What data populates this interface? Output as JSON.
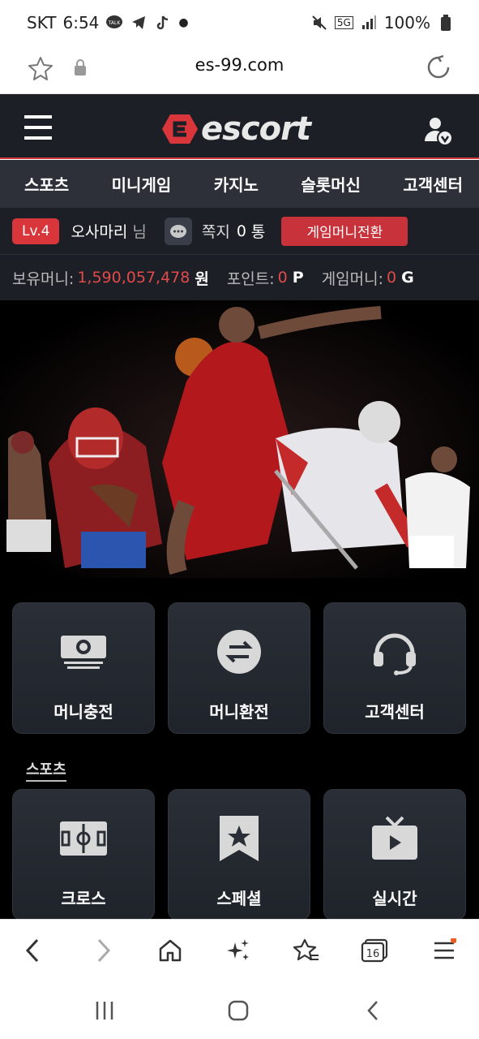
{
  "status": {
    "carrier": "SKT",
    "time": "6:54",
    "talk_label": "TALK",
    "network": "5G",
    "battery": "100%"
  },
  "browser": {
    "url": "es-99.com",
    "tabs_count": "16"
  },
  "site": {
    "logo_text": "escort",
    "nav": [
      "스포츠",
      "미니게임",
      "카지노",
      "슬롯머신",
      "고객센터"
    ],
    "user": {
      "level": "Lv.4",
      "name": "오사마리",
      "honorific": "님",
      "messages_label": "쪽지",
      "messages_count": "0",
      "messages_unit": "통",
      "convert_label": "게임머니전환"
    },
    "money": {
      "balance_label": "보유머니:",
      "balance_value": "1,590,057,478",
      "balance_unit": "원",
      "points_label": "포인트:",
      "points_value": "0",
      "points_unit": "P",
      "game_label": "게임머니:",
      "game_value": "0",
      "game_unit": "G"
    },
    "quick_tiles": [
      {
        "label": "머니충전",
        "icon": "money-icon"
      },
      {
        "label": "머니환전",
        "icon": "exchange-icon"
      },
      {
        "label": "고객센터",
        "icon": "headset-icon"
      }
    ],
    "sports_section_title": "스포츠",
    "sports_tiles": [
      {
        "label": "크로스",
        "icon": "field-icon"
      },
      {
        "label": "스페셜",
        "icon": "bookmark-star-icon"
      },
      {
        "label": "실시간",
        "icon": "tv-icon"
      }
    ]
  },
  "colors": {
    "accent_red": "#d8363b",
    "header_bg": "#1c1f26",
    "nav_bg": "#2d3039",
    "money_red": "#e24a4a"
  }
}
